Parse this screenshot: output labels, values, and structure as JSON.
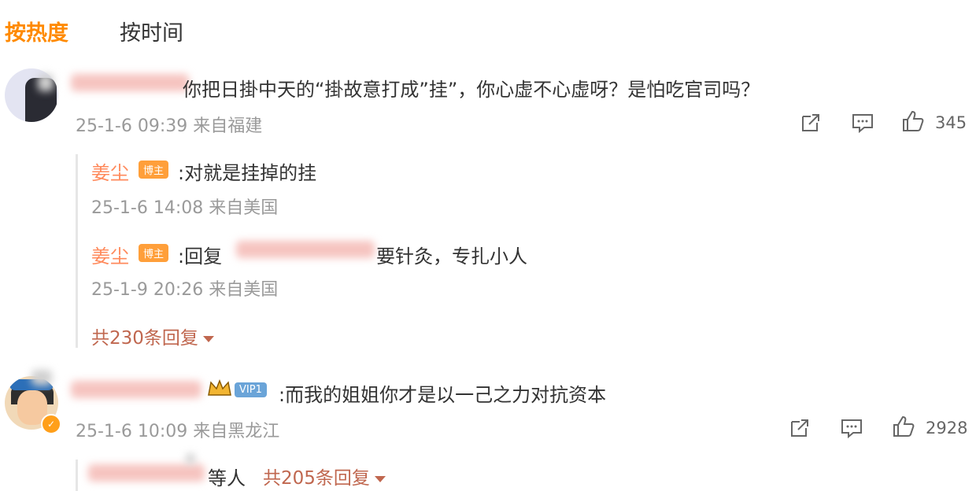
{
  "tabs": {
    "hot": "按热度",
    "time": "按时间"
  },
  "comments": [
    {
      "text_visible": "你把日掛中天的“掛故意打成”挂”，你心虚不心虚呀？是怕吃官司吗？",
      "date": "25-1-6 09:39",
      "location": "来自福建",
      "likes": "345",
      "replies": [
        {
          "name": "姜尘",
          "badge": "博主",
          "text": ":对就是挂掉的挂",
          "date": "25-1-6 14:08",
          "location": "来自美国"
        },
        {
          "name": "姜尘",
          "badge": "博主",
          "text_prefix": ":回复",
          "text_suffix": "要针灸，专扎小人",
          "date": "25-1-9 20:26",
          "location": "来自美国"
        }
      ],
      "reply_total": "共230条回复"
    },
    {
      "vip_badge": "VIP1",
      "text": ":而我的姐姐你才是以一己之力对抗资本",
      "date": "25-1-6 10:09",
      "location": "来自黑龙江",
      "likes": "2928",
      "others_suffix": "等人",
      "reply_total": "共205条回复"
    }
  ],
  "icons": [
    "share-icon",
    "comment-icon",
    "like-icon"
  ]
}
